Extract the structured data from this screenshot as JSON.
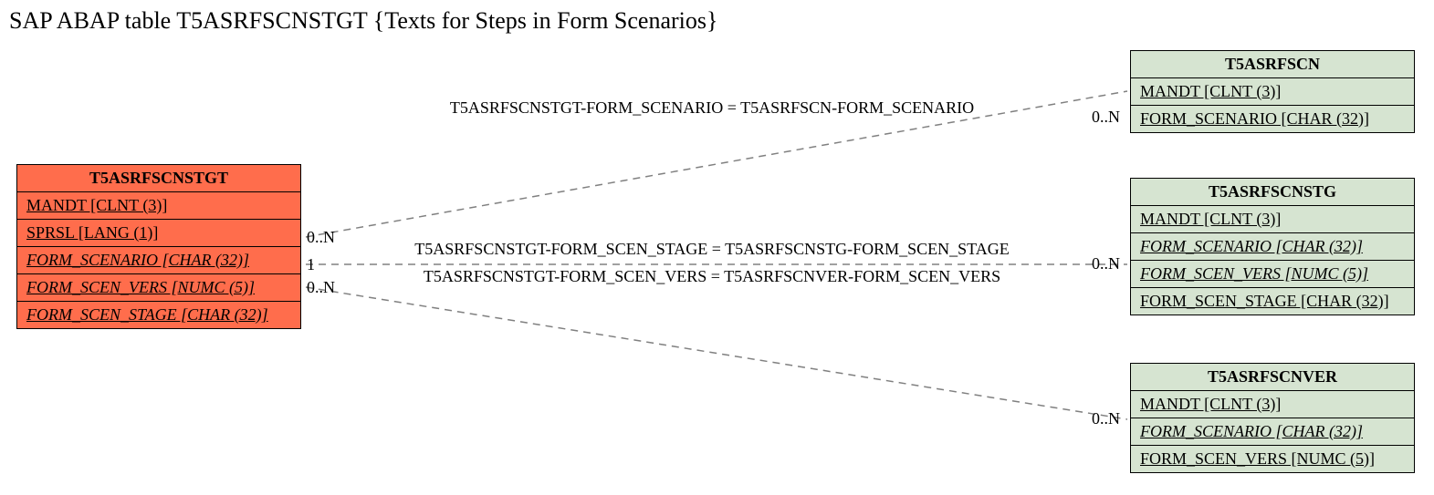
{
  "title": "SAP ABAP table T5ASRFSCNSTGT {Texts for Steps in Form Scenarios}",
  "main": {
    "name": "T5ASRFSCNSTGT",
    "fields": {
      "f0": "MANDT [CLNT (3)]",
      "f1": "SPRSL [LANG (1)]",
      "f2": "FORM_SCENARIO [CHAR (32)]",
      "f3": "FORM_SCEN_VERS [NUMC (5)]",
      "f4": "FORM_SCEN_STAGE [CHAR (32)]"
    },
    "card": {
      "c0": "0..N",
      "c1": "1",
      "c2": "0..N"
    }
  },
  "rel": [
    {
      "name": "T5ASRFSCN",
      "fields": {
        "f0": "MANDT [CLNT (3)]",
        "f1": "FORM_SCENARIO [CHAR (32)]"
      },
      "card": "0..N",
      "join": "T5ASRFSCNSTGT-FORM_SCENARIO = T5ASRFSCN-FORM_SCENARIO"
    },
    {
      "name": "T5ASRFSCNSTG",
      "fields": {
        "f0": "MANDT [CLNT (3)]",
        "f1": "FORM_SCENARIO [CHAR (32)]",
        "f2": "FORM_SCEN_VERS [NUMC (5)]",
        "f3": "FORM_SCEN_STAGE [CHAR (32)]"
      },
      "card": "0..N",
      "join": "T5ASRFSCNSTGT-FORM_SCEN_STAGE = T5ASRFSCNSTG-FORM_SCEN_STAGE"
    },
    {
      "name": "T5ASRFSCNVER",
      "fields": {
        "f0": "MANDT [CLNT (3)]",
        "f1": "FORM_SCENARIO [CHAR (32)]",
        "f2": "FORM_SCEN_VERS [NUMC (5)]"
      },
      "card": "0..N",
      "join": "T5ASRFSCNSTGT-FORM_SCEN_VERS = T5ASRFSCNVER-FORM_SCEN_VERS"
    }
  ]
}
